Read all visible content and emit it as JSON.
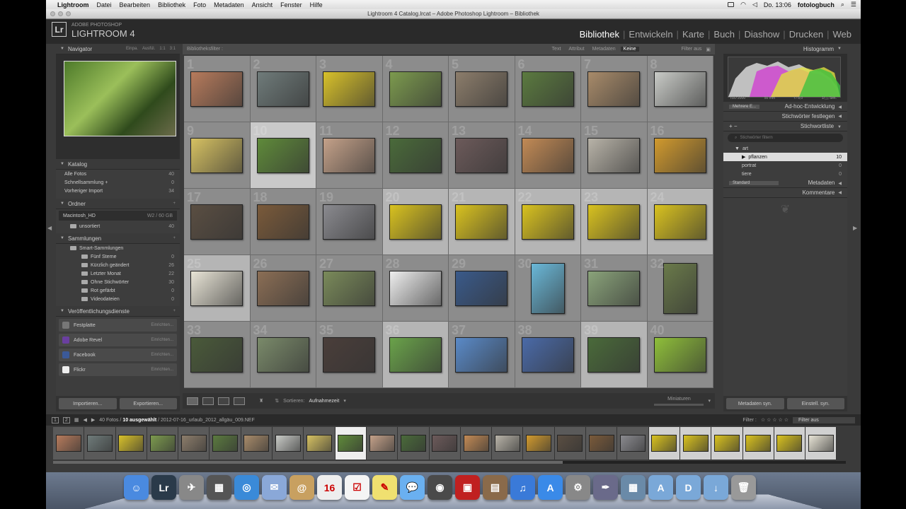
{
  "menubar": {
    "app": "Lightroom",
    "items": [
      "Datei",
      "Bearbeiten",
      "Bibliothek",
      "Foto",
      "Metadaten",
      "Ansicht",
      "Fenster",
      "Hilfe"
    ],
    "clock": "Do. 13:06",
    "user": "fotologbuch"
  },
  "window": {
    "title": "Lightroom 4 Catalog.lrcat – Adobe Photoshop Lightroom – Bibliothek"
  },
  "brand": {
    "line1": "ADOBE PHOTOSHOP",
    "line2": "LIGHTROOM 4",
    "logo": "Lr"
  },
  "modules": [
    {
      "label": "Bibliothek",
      "active": true
    },
    {
      "label": "Entwickeln"
    },
    {
      "label": "Karte"
    },
    {
      "label": "Buch"
    },
    {
      "label": "Diashow"
    },
    {
      "label": "Drucken"
    },
    {
      "label": "Web"
    }
  ],
  "navigator": {
    "title": "Navigator",
    "opts": [
      "Einpa.",
      "Ausfül.",
      "1:1",
      "3:1"
    ]
  },
  "catalog": {
    "title": "Katalog",
    "items": [
      {
        "label": "Alle Fotos",
        "count": "40"
      },
      {
        "label": "Schnellsammlung +",
        "count": "0"
      },
      {
        "label": "Vorheriger Import",
        "count": "34"
      }
    ]
  },
  "folders": {
    "title": "Ordner",
    "drive": "Macintosh_HD",
    "drive_info": "W2 / 60 GB",
    "items": [
      {
        "label": "unsortiert",
        "count": "40"
      }
    ]
  },
  "collections": {
    "title": "Sammlungen",
    "parent": "Smart-Sammlungen",
    "items": [
      {
        "label": "Fünf Sterne",
        "count": "0"
      },
      {
        "label": "Kürzlich geändert",
        "count": "26"
      },
      {
        "label": "Letzter Monat",
        "count": "22"
      },
      {
        "label": "Ohne Stichwörter",
        "count": "30"
      },
      {
        "label": "Rot gefärbt",
        "count": "0"
      },
      {
        "label": "Videodateien",
        "count": "0"
      }
    ]
  },
  "publish": {
    "title": "Veröffentlichungsdienste",
    "items": [
      {
        "label": "Festplatte",
        "action": "Einrichten...",
        "color": "#777"
      },
      {
        "label": "Adobe Revel",
        "action": "Einrichten...",
        "color": "#6a3fa0"
      },
      {
        "label": "Facebook",
        "action": "Einrichten...",
        "color": "#3b5998"
      },
      {
        "label": "Flickr",
        "action": "Einrichten...",
        "color": "#eee"
      }
    ]
  },
  "left_buttons": {
    "import": "Importieren...",
    "export": "Exportieren..."
  },
  "filterbar": {
    "label": "Bibliotheksfilter :",
    "tabs": [
      "Text",
      "Attribut",
      "Metadaten",
      "Keine"
    ],
    "active": "Keine",
    "filter_off": "Filter aus"
  },
  "grid": {
    "cells": [
      {
        "n": "1",
        "c": "#b77b5c"
      },
      {
        "n": "2",
        "c": "#6f7b7a"
      },
      {
        "n": "3",
        "c": "#d8c12a"
      },
      {
        "n": "4",
        "c": "#7c9a4e"
      },
      {
        "n": "5",
        "c": "#8c7d6b"
      },
      {
        "n": "6",
        "c": "#5b7a3f"
      },
      {
        "n": "7",
        "c": "#a88b6a"
      },
      {
        "n": "8",
        "c": "#c9cbc7"
      },
      {
        "n": "9",
        "c": "#d6c162"
      },
      {
        "n": "10",
        "c": "#5f8a3a",
        "state": "sel"
      },
      {
        "n": "11",
        "c": "#c4a189"
      },
      {
        "n": "12",
        "c": "#4a6a3a"
      },
      {
        "n": "13",
        "c": "#6c5a5a"
      },
      {
        "n": "14",
        "c": "#c28a55"
      },
      {
        "n": "15",
        "c": "#b8b3a8"
      },
      {
        "n": "16",
        "c": "#d19a2e"
      },
      {
        "n": "17",
        "c": "#5a4e42"
      },
      {
        "n": "18",
        "c": "#7a5a3a"
      },
      {
        "n": "19",
        "c": "#8a8a8f"
      },
      {
        "n": "20",
        "c": "#d9c21f",
        "state": "lite"
      },
      {
        "n": "21",
        "c": "#d9c21f",
        "state": "lite"
      },
      {
        "n": "22",
        "c": "#d9c21f",
        "state": "lite"
      },
      {
        "n": "23",
        "c": "#d9c21f",
        "state": "lite"
      },
      {
        "n": "24",
        "c": "#d9c21f",
        "state": "lite"
      },
      {
        "n": "25",
        "c": "#e8e4d6",
        "state": "lite"
      },
      {
        "n": "26",
        "c": "#8b6e55"
      },
      {
        "n": "27",
        "c": "#7a8a5a"
      },
      {
        "n": "28",
        "c": "#eeeeee"
      },
      {
        "n": "29",
        "c": "#3a5a8a"
      },
      {
        "n": "30",
        "c": "#6ab8d8",
        "portrait": true
      },
      {
        "n": "31",
        "c": "#8aa37a"
      },
      {
        "n": "32",
        "c": "#6a7a4a",
        "portrait": true
      },
      {
        "n": "33",
        "c": "#4a5a3a"
      },
      {
        "n": "34",
        "c": "#7a8a6a"
      },
      {
        "n": "35",
        "c": "#4a3e3a"
      },
      {
        "n": "36",
        "c": "#6aa24a",
        "state": "lite"
      },
      {
        "n": "37",
        "c": "#5a8ac8"
      },
      {
        "n": "38",
        "c": "#4a6aa8"
      },
      {
        "n": "39",
        "c": "#4a6a3a",
        "state": "lite"
      },
      {
        "n": "40",
        "c": "#8fbf3a"
      }
    ]
  },
  "toolbar": {
    "sort_label": "Sortieren:",
    "sort_value": "Aufnahmezeit",
    "thumbs": "Miniaturen"
  },
  "right": {
    "histogram": "Histogramm",
    "hist_info": [
      "ISO 2000",
      "50 mm",
      "f / 8,0",
      "1/₁₂₅ Sek."
    ],
    "quick_preset": "Mehrere E...",
    "quick_dev": "Ad-hoc-Entwicklung",
    "kw_set": "Stichwörter festlegen",
    "kw_list": "Stichwortliste",
    "kw_search": "Stichwörter filtern",
    "keywords": [
      {
        "label": "art",
        "count": ""
      },
      {
        "label": "pflanzen",
        "count": "10",
        "hl": true
      },
      {
        "label": "portrat",
        "count": "0"
      },
      {
        "label": "tiere",
        "count": "0"
      }
    ],
    "meta_preset": "Standard",
    "metadata": "Metadaten",
    "comments": "Kommentare",
    "sync_meta": "Metadaten syn.",
    "sync_settings": "Einstell. syn."
  },
  "filmstrip": {
    "info_count": "40 Fotos /",
    "info_sel": "10 ausgewählt",
    "info_file": "/ 2012-07-16_urlaub_2012_allgäu_009.NEF",
    "filter_label": "Filter :",
    "filter_value": "Filter aus",
    "thumbs": [
      {
        "c": "#b77b5c"
      },
      {
        "c": "#6f7b7a"
      },
      {
        "c": "#d8c12a"
      },
      {
        "c": "#7c9a4e"
      },
      {
        "c": "#8c7d6b"
      },
      {
        "c": "#5b7a3f"
      },
      {
        "c": "#a88b6a"
      },
      {
        "c": "#c9cbc7"
      },
      {
        "c": "#d6c162"
      },
      {
        "c": "#5f8a3a",
        "s": "sel"
      },
      {
        "c": "#c4a189"
      },
      {
        "c": "#4a6a3a"
      },
      {
        "c": "#6c5a5a"
      },
      {
        "c": "#c28a55"
      },
      {
        "c": "#b8b3a8"
      },
      {
        "c": "#d19a2e"
      },
      {
        "c": "#5a4e42"
      },
      {
        "c": "#7a5a3a"
      },
      {
        "c": "#8a8a8f"
      },
      {
        "c": "#d9c21f",
        "s": "lite"
      },
      {
        "c": "#d9c21f",
        "s": "lite"
      },
      {
        "c": "#d9c21f",
        "s": "lite"
      },
      {
        "c": "#d9c21f",
        "s": "lite"
      },
      {
        "c": "#d9c21f",
        "s": "lite"
      },
      {
        "c": "#e8e4d6",
        "s": "lite"
      }
    ]
  },
  "dock": [
    {
      "name": "finder-icon",
      "c": "#4a8ae0",
      "t": "☺"
    },
    {
      "name": "lightroom-icon",
      "c": "#2a3a4a",
      "t": "Lr"
    },
    {
      "name": "launchpad-icon",
      "c": "#888",
      "t": "✈"
    },
    {
      "name": "mission-control-icon",
      "c": "#555",
      "t": "▦"
    },
    {
      "name": "safari-icon",
      "c": "#3a8ad8",
      "t": "◎"
    },
    {
      "name": "mail-icon",
      "c": "#8aa8d8",
      "t": "✉"
    },
    {
      "name": "contacts-icon",
      "c": "#c8a060",
      "t": "@"
    },
    {
      "name": "calendar-icon",
      "c": "#eee",
      "t": "16"
    },
    {
      "name": "reminders-icon",
      "c": "#f4f4f4",
      "t": "☑"
    },
    {
      "name": "notes-icon",
      "c": "#f0e070",
      "t": "✎"
    },
    {
      "name": "messages-icon",
      "c": "#6ab0f0",
      "t": "💬"
    },
    {
      "name": "facetime-icon",
      "c": "#4a4a4a",
      "t": "◉"
    },
    {
      "name": "photo-booth-icon",
      "c": "#c02020",
      "t": "▣"
    },
    {
      "name": "iphoto-icon",
      "c": "#8a6a4a",
      "t": "▤"
    },
    {
      "name": "itunes-icon",
      "c": "#3a7ad8",
      "t": "♫"
    },
    {
      "name": "app-store-icon",
      "c": "#3a8ae8",
      "t": "A"
    },
    {
      "name": "system-preferences-icon",
      "c": "#888",
      "t": "⚙"
    },
    {
      "name": "script-icon",
      "c": "#6a6a8a",
      "t": "✒"
    },
    {
      "name": "preview-icon",
      "c": "#6a8aa8",
      "t": "▦"
    },
    {
      "name": "applications-folder-icon",
      "c": "#7aa8d8",
      "t": "A"
    },
    {
      "name": "documents-folder-icon",
      "c": "#7aa8d8",
      "t": "D"
    },
    {
      "name": "downloads-folder-icon",
      "c": "#7aa8d8",
      "t": "↓"
    },
    {
      "name": "trash-icon",
      "c": "#999",
      "t": "🗑"
    }
  ]
}
